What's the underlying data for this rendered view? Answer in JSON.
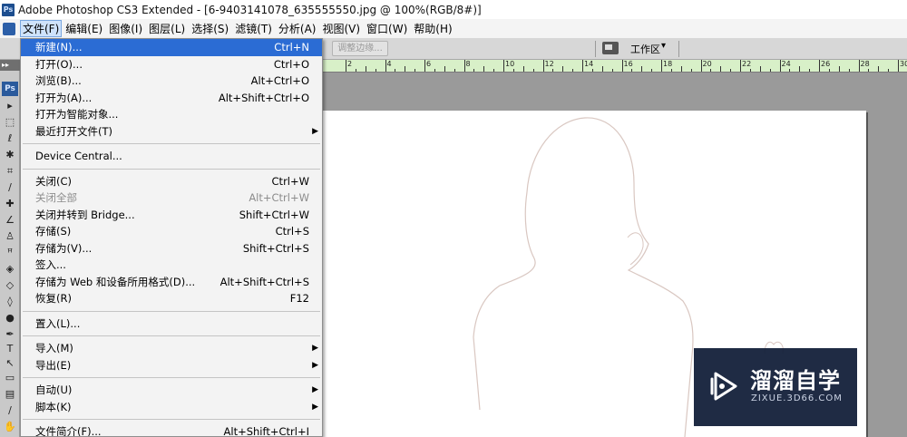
{
  "window": {
    "title": "Adobe Photoshop CS3 Extended - [6-9403141078_635555550.jpg @ 100%(RGB/8#)]",
    "logo_text": "Ps"
  },
  "menubar": {
    "items": [
      {
        "label": "文件(F)",
        "active": true
      },
      {
        "label": "编辑(E)"
      },
      {
        "label": "图像(I)"
      },
      {
        "label": "图层(L)"
      },
      {
        "label": "选择(S)"
      },
      {
        "label": "滤镜(T)"
      },
      {
        "label": "分析(A)"
      },
      {
        "label": "视图(V)"
      },
      {
        "label": "窗口(W)"
      },
      {
        "label": "帮助(H)"
      }
    ]
  },
  "optionsbar": {
    "refine_edge_label": "调整边缘...",
    "workspace_label": "工作区",
    "workspace_caret": "▾"
  },
  "toolbox": {
    "head_label": "▸▸",
    "logo_text": "Ps"
  },
  "ruler": {
    "labels": [
      "2",
      "4",
      "6",
      "8",
      "10",
      "12",
      "14",
      "16",
      "18",
      "20",
      "22",
      "24",
      "26",
      "28",
      "30"
    ]
  },
  "file_menu": {
    "items": [
      {
        "type": "item",
        "label": "新建(N)...",
        "shortcut": "Ctrl+N",
        "highlight": true
      },
      {
        "type": "item",
        "label": "打开(O)...",
        "shortcut": "Ctrl+O"
      },
      {
        "type": "item",
        "label": "浏览(B)...",
        "shortcut": "Alt+Ctrl+O"
      },
      {
        "type": "item",
        "label": "打开为(A)...",
        "shortcut": "Alt+Shift+Ctrl+O"
      },
      {
        "type": "item",
        "label": "打开为智能对象..."
      },
      {
        "type": "item",
        "label": "最近打开文件(T)",
        "submenu": true
      },
      {
        "type": "sep"
      },
      {
        "type": "item",
        "label": "Device Central..."
      },
      {
        "type": "sep"
      },
      {
        "type": "item",
        "label": "关闭(C)",
        "shortcut": "Ctrl+W"
      },
      {
        "type": "item",
        "label": "关闭全部",
        "shortcut": "Alt+Ctrl+W",
        "disabled": true
      },
      {
        "type": "item",
        "label": "关闭并转到 Bridge...",
        "shortcut": "Shift+Ctrl+W"
      },
      {
        "type": "item",
        "label": "存储(S)",
        "shortcut": "Ctrl+S"
      },
      {
        "type": "item",
        "label": "存储为(V)...",
        "shortcut": "Shift+Ctrl+S"
      },
      {
        "type": "item",
        "label": "签入..."
      },
      {
        "type": "item",
        "label": "存储为 Web 和设备所用格式(D)...",
        "shortcut": "Alt+Shift+Ctrl+S"
      },
      {
        "type": "item",
        "label": "恢复(R)",
        "shortcut": "F12"
      },
      {
        "type": "sep"
      },
      {
        "type": "item",
        "label": "置入(L)..."
      },
      {
        "type": "sep"
      },
      {
        "type": "item",
        "label": "导入(M)",
        "submenu": true
      },
      {
        "type": "item",
        "label": "导出(E)",
        "submenu": true
      },
      {
        "type": "sep"
      },
      {
        "type": "item",
        "label": "自动(U)",
        "submenu": true
      },
      {
        "type": "item",
        "label": "脚本(K)",
        "submenu": true
      },
      {
        "type": "sep"
      },
      {
        "type": "item",
        "label": "文件简介(F)...",
        "shortcut": "Alt+Shift+Ctrl+I"
      }
    ]
  },
  "watermark": {
    "title": "溜溜自学",
    "url": "ZIXUE.3D66.COM"
  },
  "colors": {
    "menu_highlight": "#2b6cd4",
    "ruler_bg": "#d8f0c8",
    "watermark_bg": "#14203a"
  }
}
